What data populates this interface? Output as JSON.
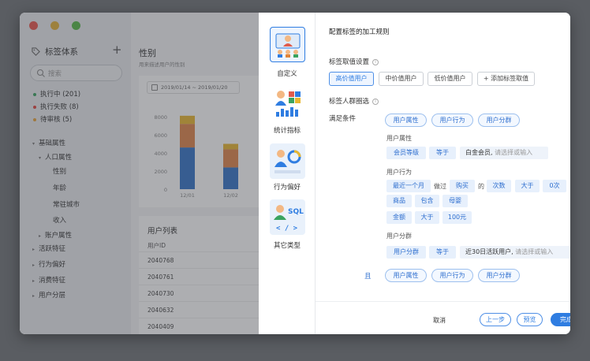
{
  "sidebar": {
    "title": "标签体系",
    "add": "+",
    "search_placeholder": "搜索",
    "statuses": [
      {
        "label": "执行中 (201)",
        "color": "#3aa35f"
      },
      {
        "label": "执行失败 (8)",
        "color": "#e0453e"
      },
      {
        "label": "待审核 (5)",
        "color": "#e7a23a"
      }
    ],
    "tree": [
      {
        "label": "基础属性",
        "arrow": "▾"
      },
      {
        "label": "人口属性",
        "arrow": "▾"
      },
      {
        "label": "性别",
        "arrow": ""
      },
      {
        "label": "年龄",
        "arrow": ""
      },
      {
        "label": "常驻城市",
        "arrow": ""
      },
      {
        "label": "收入",
        "arrow": ""
      },
      {
        "label": "账户属性",
        "arrow": "▸"
      },
      {
        "label": "活跃特征",
        "arrow": "▸"
      },
      {
        "label": "行为偏好",
        "arrow": "▸"
      },
      {
        "label": "消费特征",
        "arrow": "▸"
      },
      {
        "label": "用户分层",
        "arrow": "▸"
      }
    ]
  },
  "page": {
    "title": "性别",
    "subtitle": "用来描述用户的性别",
    "date_range": "2019/01/14 ~ 2019/01/20",
    "list_title": "用户列表",
    "list_header": "用户ID",
    "rows": [
      "2040768",
      "2040761",
      "2040730",
      "2040632",
      "2040409"
    ]
  },
  "chart_data": {
    "type": "bar",
    "categories": [
      "12/01",
      "12/02"
    ],
    "series": [
      {
        "values": [
          4600,
          2400
        ],
        "color": "#3574c9"
      },
      {
        "values": [
          2600,
          2000
        ],
        "color": "#e0854a"
      },
      {
        "values": [
          900,
          600
        ],
        "color": "#e8b731"
      }
    ],
    "ylim": [
      0,
      8000
    ],
    "yticks": [
      "8000",
      "6000",
      "4000",
      "2000",
      "0"
    ]
  },
  "types": [
    {
      "label": "自定义",
      "icon": "custom-people-icon"
    },
    {
      "label": "统计指标",
      "icon": "statistics-icon"
    },
    {
      "label": "行为偏好",
      "icon": "behavior-icon"
    },
    {
      "label": "其它类型",
      "icon": "sql-code-icon"
    }
  ],
  "panel": {
    "title": "配置标签的加工规则",
    "value_section": "标签取值设置",
    "value_tabs": [
      "高价值用户",
      "中价值用户",
      "低价值用户"
    ],
    "add_value": "+ 添加标签取值",
    "crowd_section": "标签人群圈选",
    "satisfy": "满足条件",
    "group_pills": [
      "用户属性",
      "用户行为",
      "用户分群"
    ],
    "attr": {
      "label": "用户属性",
      "field": "会员等级",
      "op": "等于",
      "value": "白金会员,",
      "input_ph": "请选择或输入"
    },
    "behavior": {
      "label": "用户行为",
      "time": "最近一个月",
      "did": "做过",
      "action": "购买",
      "of": "的",
      "count": "次数",
      "gt": "大于",
      "count_val": "0次",
      "product": "商品",
      "contains": "包含",
      "product_val": "母婴",
      "amount": "金额",
      "gt2": "大于",
      "amount_val": "100元"
    },
    "segment": {
      "label": "用户分群",
      "field": "用户分群",
      "op": "等于",
      "value": "近30日活跃用户,",
      "input_ph": "请选择或输入"
    },
    "and": "且",
    "and_pills": [
      "用户属性",
      "用户行为",
      "用户分群"
    ],
    "cancel": "取消",
    "prev": "上一步",
    "preview": "预览",
    "finish": "完成"
  }
}
